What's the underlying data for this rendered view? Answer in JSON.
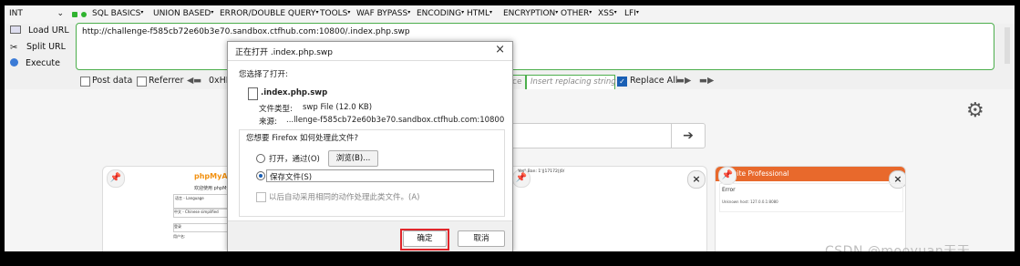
{
  "menubar": {
    "select_value": "INT",
    "items": [
      {
        "label": "SQL BASICS"
      },
      {
        "label": "UNION BASED"
      },
      {
        "label": "ERROR/DOUBLE QUERY"
      },
      {
        "label": "TOOLS"
      },
      {
        "label": "WAF BYPASS"
      },
      {
        "label": "ENCODING"
      },
      {
        "label": "HTML"
      },
      {
        "label": "ENCRYPTION"
      },
      {
        "label": "OTHER"
      },
      {
        "label": "XSS"
      },
      {
        "label": "LFI"
      }
    ]
  },
  "actions": {
    "load_url": "Load URL",
    "split_url": "Split URL",
    "execute": "Execute"
  },
  "url": {
    "value": "http://challenge-f585cb72e60b3e70.sandbox.ctfhub.com:10800/.index.php.swp"
  },
  "options": {
    "post_data": "Post data",
    "referrer": "Referrer",
    "hex_fragment": "0xHE",
    "replace_fragment": "ce",
    "replace_placeholder": "Insert replacing string",
    "replace_all": "Replace All"
  },
  "tiles": {
    "phpmyadmin_logo": "phpMyAdmin",
    "phpmyadmin_welcome": "欢迎使用 phpMy",
    "phpmyadmin_language": "语言 - Language",
    "phpmyadmin_lang_value": "中文 - Chinese simplified",
    "phpmyadmin_login": "登录",
    "phpmyadmin_user": "用户名:",
    "middle_tile_text": "Yes\" Ban: 1'||17172||0/",
    "burp_title": "Suite Professional",
    "burp_error": "Error",
    "burp_msg": "Unknown host: 127.0.0.1:8080"
  },
  "dialog": {
    "title": "正在打开 .index.php.swp",
    "chosen_label": "您选择了打开:",
    "filename": ".index.php.swp",
    "type_label": "文件类型:",
    "type_value": "swp File (12.0 KB)",
    "source_label": "来源:",
    "source_value": "...llenge-f585cb72e60b3e70.sandbox.ctfhub.com:10800",
    "question": "您想要 Firefox 如何处理此文件?",
    "open_with": "打开，通过(O)",
    "browse_button": "浏览(B)...",
    "save_file": "保存文件(S)",
    "remember": "以后自动采用相同的动作处理此类文件。(A)",
    "ok": "确定",
    "cancel": "取消"
  },
  "watermark": "CSDN @mooyuan天天",
  "colors": {
    "url_border": "#4cae4c",
    "highlight": "#e0262b",
    "burp_orange": "#e8692c",
    "accent_blue": "#1a5fb4"
  }
}
